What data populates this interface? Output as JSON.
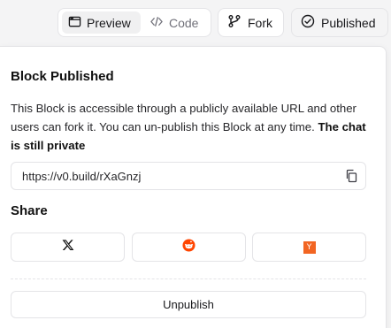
{
  "toolbar": {
    "view_toggle": {
      "preview_label": "Preview",
      "code_label": "Code",
      "selected": "Preview"
    },
    "fork_label": "Fork",
    "published_label": "Published"
  },
  "popover": {
    "title": "Block Published",
    "description": "This Block is accessible through a publicly available URL and other users can fork it. You can un-publish this Block at any time.",
    "description_bold": "The chat is still private",
    "url": "https://v0.build/rXaGnzj",
    "share_title": "Share",
    "share_buttons": [
      {
        "icon": "x-logo-icon"
      },
      {
        "icon": "reddit-icon"
      },
      {
        "icon": "hacker-news-icon",
        "badge_text": "Y"
      }
    ],
    "unpublish_label": "Unpublish"
  },
  "colors": {
    "reddit": "#ff4500",
    "hacker_news": "#f26522",
    "border": "#e4e4e7",
    "background": "#f4f4f5"
  }
}
